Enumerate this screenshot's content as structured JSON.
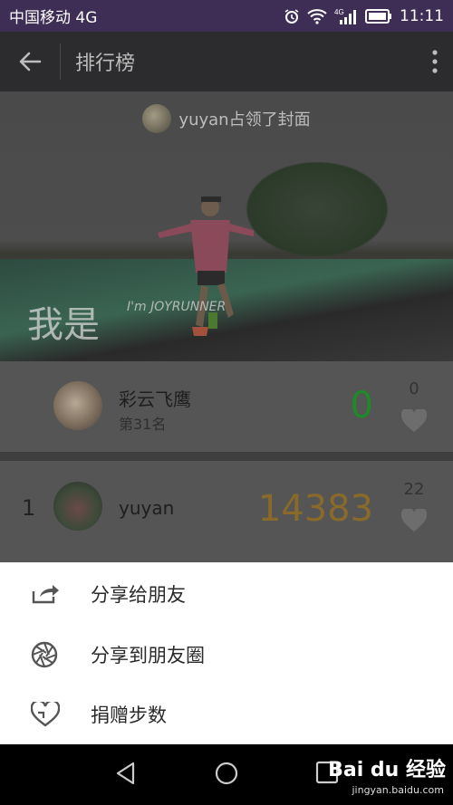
{
  "status_bar": {
    "carrier": "中国移动 4G",
    "network_badge": "4G",
    "time": "11:11",
    "icons": [
      "alarm-icon",
      "wifi-icon",
      "signal-icon",
      "battery-icon"
    ]
  },
  "app_bar": {
    "title": "排行榜",
    "icons": [
      "back-arrow-icon",
      "more-vert-icon"
    ]
  },
  "cover": {
    "caption": "yuyan占领了封面",
    "brand_text": "我是",
    "brand_sub": "I'm JOYRUNNER"
  },
  "me_row": {
    "name": "彩云飞鹰",
    "rank_text": "第31名",
    "steps": "0",
    "likes": "0"
  },
  "rank_list": [
    {
      "rank": "1",
      "name": "yuyan",
      "steps": "14383",
      "likes": "22"
    }
  ],
  "share_sheet": {
    "items": [
      {
        "label": "分享给朋友",
        "icon": "share-icon"
      },
      {
        "label": "分享到朋友圈",
        "icon": "moments-aperture-icon"
      },
      {
        "label": "捐赠步数",
        "icon": "donate-heart-icon"
      }
    ]
  },
  "nav_bar": {
    "icons": [
      "nav-back-icon",
      "nav-home-icon",
      "nav-recents-icon"
    ]
  },
  "watermark": {
    "text": "Bai du 经验",
    "sub": "jingyan.baidu.com"
  },
  "colors": {
    "steps_me": "#1e8a2a",
    "steps_top": "#8a6a2a",
    "status_bar": "#3e2e55"
  }
}
